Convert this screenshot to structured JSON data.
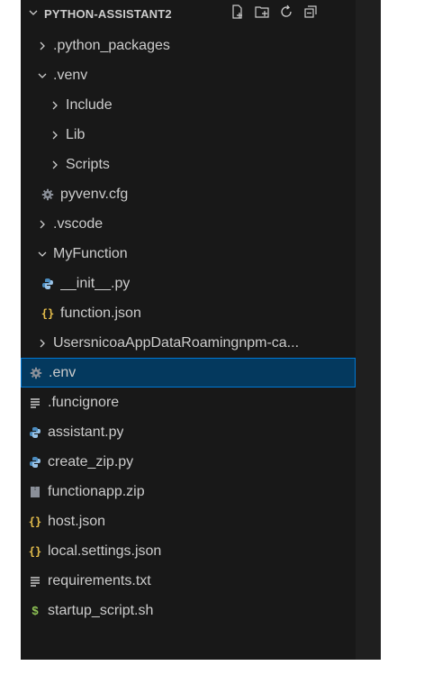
{
  "explorer": {
    "title": "PYTHON-ASSISTANT2",
    "actions": [
      "new-file-icon",
      "new-folder-icon",
      "refresh-icon",
      "collapse-all-icon"
    ],
    "items": [
      {
        "label": ".python_packages",
        "type": "folder",
        "expanded": false,
        "depth": 0
      },
      {
        "label": ".venv",
        "type": "folder",
        "expanded": true,
        "depth": 0
      },
      {
        "label": "Include",
        "type": "folder",
        "expanded": false,
        "depth": 1
      },
      {
        "label": "Lib",
        "type": "folder",
        "expanded": false,
        "depth": 1
      },
      {
        "label": "Scripts",
        "type": "folder",
        "expanded": false,
        "depth": 1
      },
      {
        "label": "pyvenv.cfg",
        "type": "file",
        "icon": "gear-icon",
        "depth": 1
      },
      {
        "label": ".vscode",
        "type": "folder",
        "expanded": false,
        "depth": 0
      },
      {
        "label": "MyFunction",
        "type": "folder",
        "expanded": true,
        "depth": 0
      },
      {
        "label": "__init__.py",
        "type": "file",
        "icon": "python-icon",
        "depth": 1
      },
      {
        "label": "function.json",
        "type": "file",
        "icon": "json-braces-icon",
        "depth": 1
      },
      {
        "label": "UsersnicoaAppDataRoamingnpm-ca...",
        "type": "folder",
        "expanded": false,
        "depth": 0
      },
      {
        "label": ".env",
        "type": "file",
        "icon": "gear-icon",
        "depth": 0,
        "selected": true
      },
      {
        "label": ".funcignore",
        "type": "file",
        "icon": "lines-icon",
        "depth": 0
      },
      {
        "label": "assistant.py",
        "type": "file",
        "icon": "python-icon",
        "depth": 0
      },
      {
        "label": "create_zip.py",
        "type": "file",
        "icon": "python-icon",
        "depth": 0
      },
      {
        "label": "functionapp.zip",
        "type": "file",
        "icon": "zip-icon",
        "depth": 0
      },
      {
        "label": "host.json",
        "type": "file",
        "icon": "json-braces-icon",
        "depth": 0
      },
      {
        "label": "local.settings.json",
        "type": "file",
        "icon": "json-braces-icon",
        "depth": 0
      },
      {
        "label": "requirements.txt",
        "type": "file",
        "icon": "lines-icon",
        "depth": 0
      },
      {
        "label": "startup_script.sh",
        "type": "file",
        "icon": "shell-dollar-icon",
        "depth": 0
      }
    ]
  },
  "colors": {
    "background": "#181818",
    "text": "#cccccc",
    "selection_bg": "#04395e",
    "selection_border": "#0078d4"
  }
}
